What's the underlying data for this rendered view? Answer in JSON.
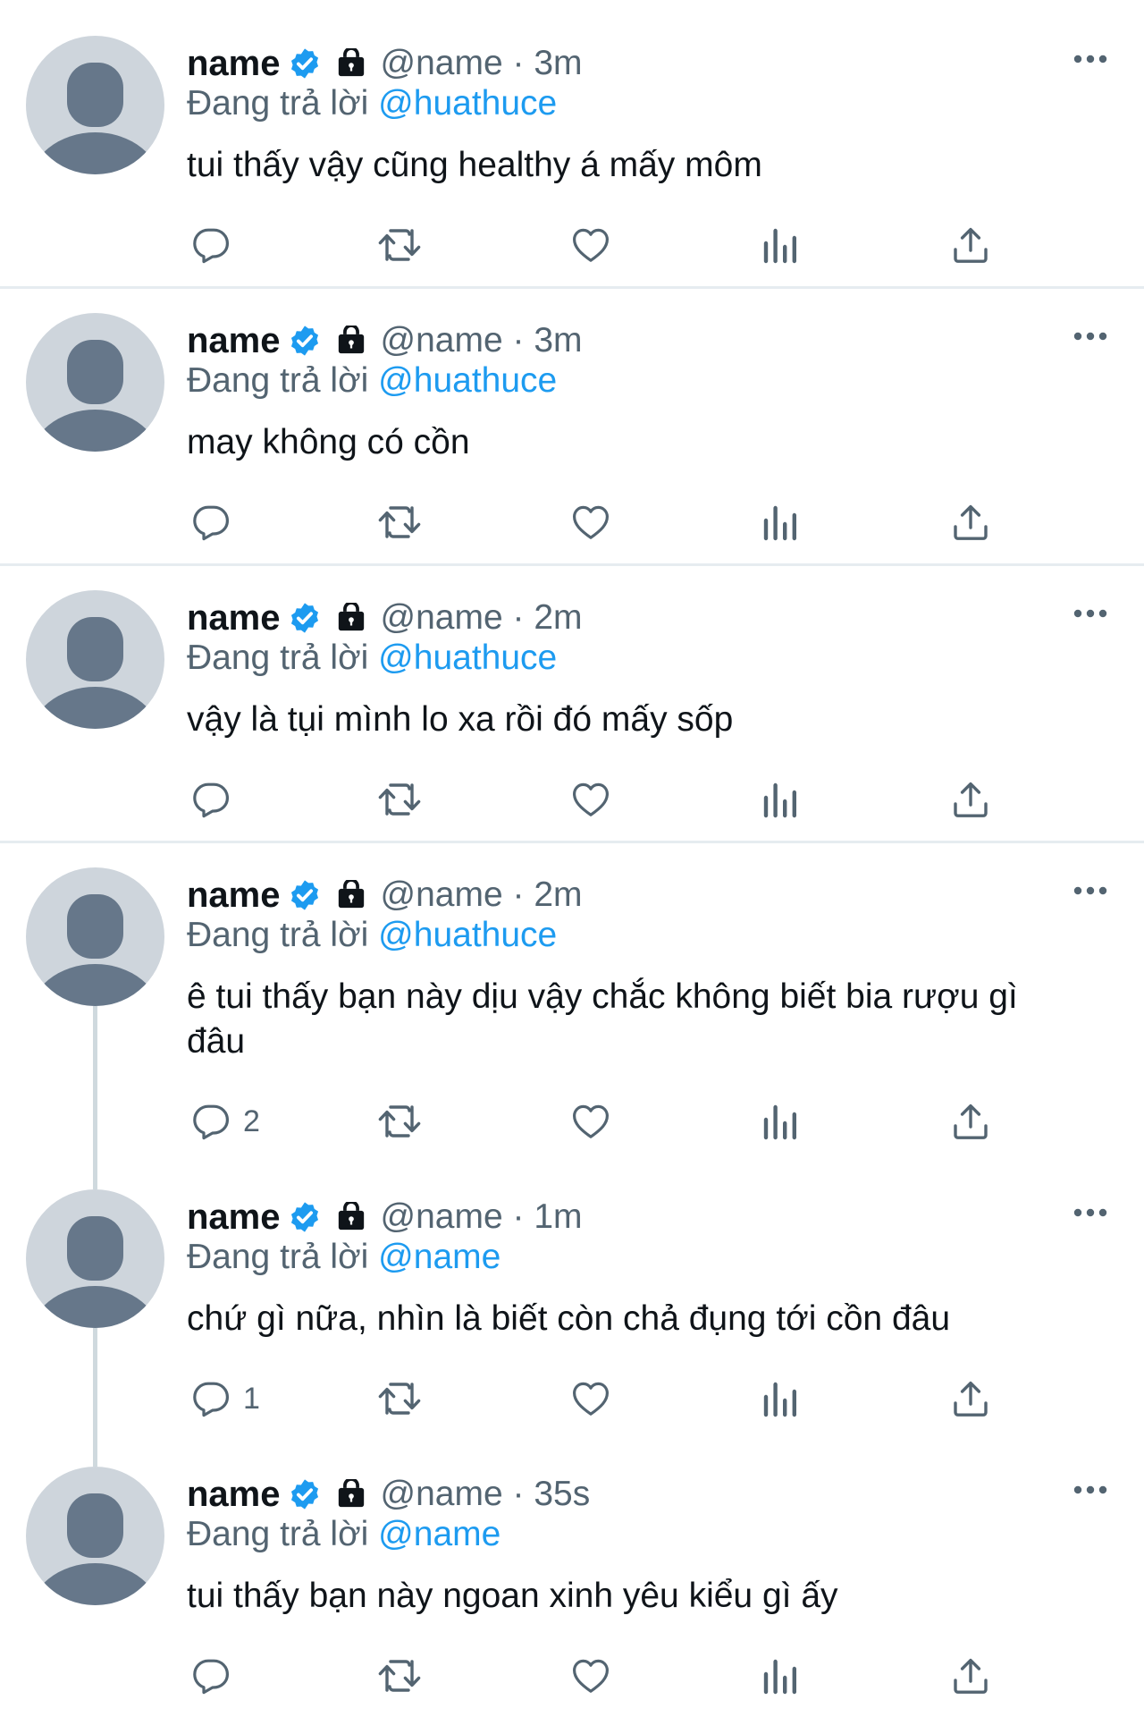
{
  "tweets": [
    {
      "name": "name",
      "handle": "@name",
      "time": "· 3m",
      "replying_prefix": "Đang trả lời",
      "replying_to": "@huathuce",
      "text": "tui thấy vậy cũng healthy á mấy môm",
      "reply_count": ""
    },
    {
      "name": "name",
      "handle": "@name",
      "time": "· 3m",
      "replying_prefix": "Đang trả lời",
      "replying_to": "@huathuce",
      "text": "may không có cồn",
      "reply_count": ""
    },
    {
      "name": "name",
      "handle": "@name",
      "time": "· 2m",
      "replying_prefix": "Đang trả lời",
      "replying_to": "@huathuce",
      "text": "vậy là tụi mình lo xa rồi đó mấy sốp",
      "reply_count": ""
    },
    {
      "name": "name",
      "handle": "@name",
      "time": "· 2m",
      "replying_prefix": "Đang trả lời",
      "replying_to": "@huathuce",
      "text": "ê tui thấy bạn này dịu vậy chắc không biết bia rượu gì đâu",
      "reply_count": "2"
    },
    {
      "name": "name",
      "handle": "@name",
      "time": "· 1m",
      "replying_prefix": "Đang trả lời",
      "replying_to": "@name",
      "text": "chứ gì nữa, nhìn là biết còn chả đụng tới cồn đâu",
      "reply_count": "1"
    },
    {
      "name": "name",
      "handle": "@name",
      "time": "· 35s",
      "replying_prefix": "Đang trả lời",
      "replying_to": "@name",
      "text": "tui thấy bạn này ngoan xinh yêu kiểu gì ấy",
      "reply_count": ""
    }
  ],
  "icons": {
    "avatar": "default-avatar-icon",
    "verified": "verified-badge-icon",
    "lock": "protected-lock-icon",
    "more": "more-options-icon",
    "reply": "reply-icon",
    "retweet": "retweet-icon",
    "like": "like-icon",
    "views": "views-icon",
    "share": "share-icon"
  },
  "colors": {
    "accent": "#1d9bf0",
    "muted": "#536471",
    "text": "#0f1419",
    "avatar_bg": "#ced5dc",
    "avatar_fg": "#66778a"
  }
}
